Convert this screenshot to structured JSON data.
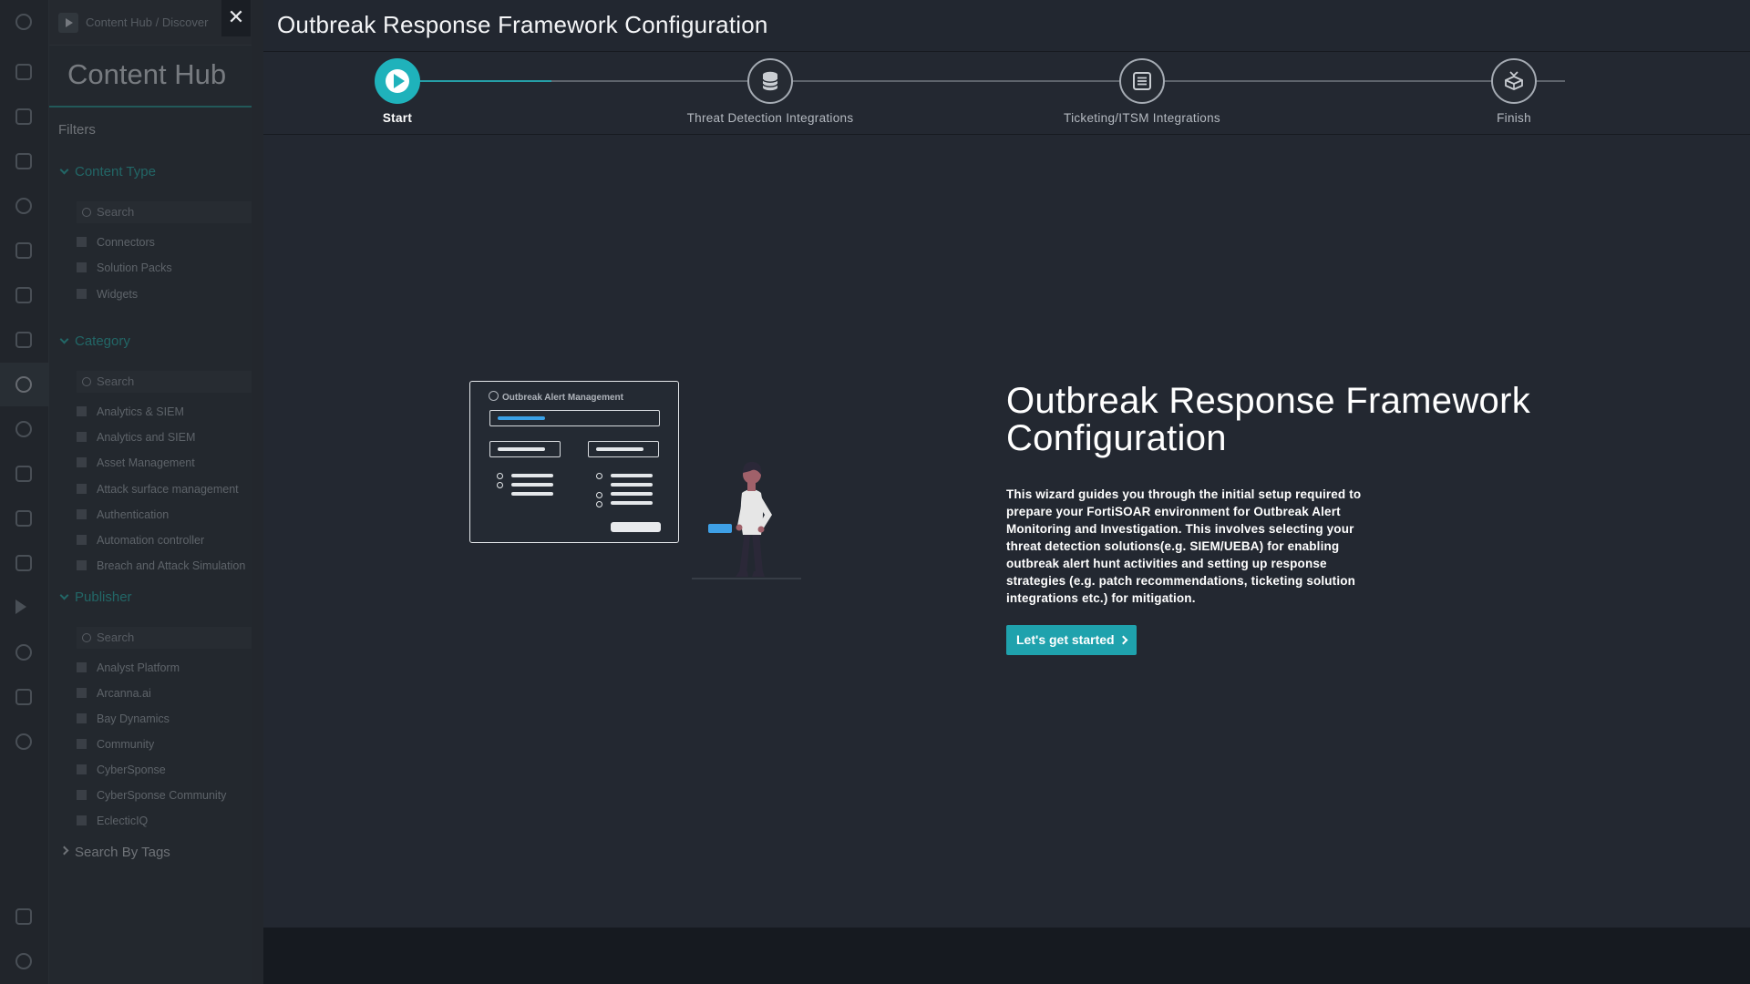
{
  "background": {
    "breadcrumb": "Content Hub  /  Discover",
    "hub_title": "Content Hub",
    "filters_label": "Filters",
    "sections": {
      "content_type": {
        "label": "Content Type",
        "search_placeholder": "Search",
        "items": [
          "Connectors",
          "Solution Packs",
          "Widgets"
        ]
      },
      "category": {
        "label": "Category",
        "search_placeholder": "Search",
        "items": [
          "Analytics & SIEM",
          "Analytics and SIEM",
          "Asset Management",
          "Attack surface management",
          "Authentication",
          "Automation controller",
          "Breach and Attack Simulation"
        ]
      },
      "publisher": {
        "label": "Publisher",
        "search_placeholder": "Search",
        "items": [
          "Analyst Platform",
          "Arcanna.ai",
          "Bay Dynamics",
          "Community",
          "CyberSponse",
          "CyberSponse Community",
          "EclecticIQ"
        ]
      },
      "tags": {
        "label": "Search By Tags"
      }
    }
  },
  "modal": {
    "close_icon": "close-icon",
    "title": "Outbreak Response Framework Configuration",
    "steps": [
      {
        "label": "Start",
        "icon": "play-icon",
        "active": true
      },
      {
        "label": "Threat Detection Integrations",
        "icon": "database-icon",
        "active": false
      },
      {
        "label": "Ticketing/ITSM Integrations",
        "icon": "list-icon",
        "active": false
      },
      {
        "label": "Finish",
        "icon": "box-icon",
        "active": false
      }
    ],
    "progress_fraction_of_first_segment": 0.35,
    "illustration": {
      "window_title": "Outbreak Alert Management"
    },
    "hero_title": "Outbreak Response Framework Configuration",
    "hero_description": "This wizard guides you through the initial setup required to prepare your FortiSOAR environment for Outbreak Alert Monitoring and Investigation. This involves selecting your threat detection solutions(e.g. SIEM/UEBA) for enabling outbreak alert hunt activities and setting up response strategies (e.g. patch recommendations, ticketing solution integrations etc.) for mitigation.",
    "start_button": "Let's get started"
  },
  "colors": {
    "accent": "#1fa2ad",
    "modal_bg": "#232831",
    "footer_bg": "#161a20",
    "hub_accent": "#2fa7a3"
  }
}
